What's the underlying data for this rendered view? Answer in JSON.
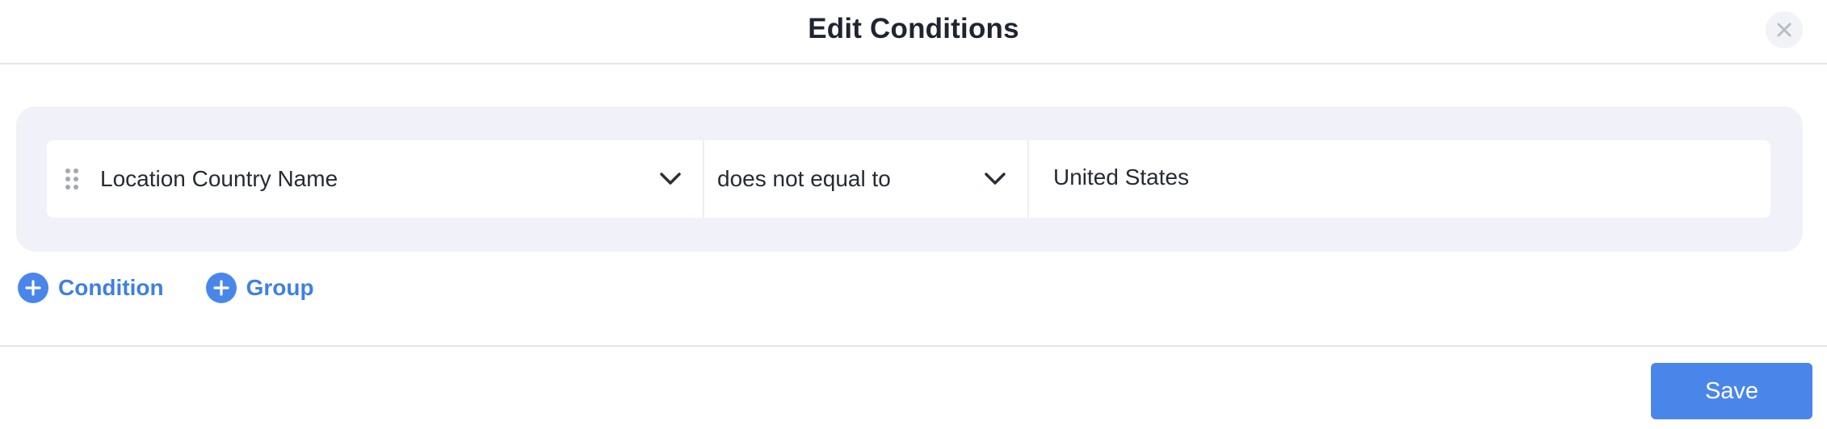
{
  "dialog": {
    "title": "Edit Conditions"
  },
  "condition": {
    "field": "Location Country Name",
    "operator": "does not equal to",
    "value": "United States"
  },
  "actions": {
    "add_condition_label": "Condition",
    "add_group_label": "Group"
  },
  "footer": {
    "save_label": "Save"
  },
  "icons": {
    "close": "close-icon",
    "drag": "drag-handle-icon",
    "chevron": "chevron-down-icon",
    "plus": "plus-icon"
  },
  "colors": {
    "accent": "#4a86ea",
    "panel_bg": "#f1f2f9",
    "text": "#262b33"
  }
}
